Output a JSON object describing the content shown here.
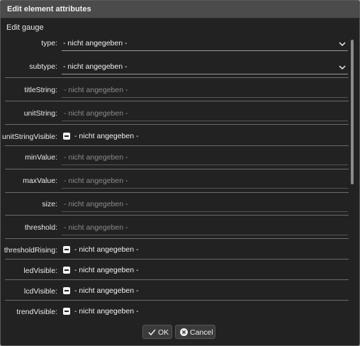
{
  "dialog": {
    "title": "Edit element attributes",
    "subtitle": "Edit gauge"
  },
  "fields": {
    "type": {
      "label": "type:",
      "value": "- nicht angegeben -"
    },
    "subtype": {
      "label": "subtype:",
      "value": "- nicht angegeben -"
    },
    "titleString": {
      "label": "titleString:",
      "placeholder": "- nicht angegeben -"
    },
    "unitString": {
      "label": "unitString:",
      "placeholder": "- nicht angegeben -"
    },
    "unitStringVisible": {
      "label": "unitStringVisible:",
      "value": "- nicht angegeben -"
    },
    "minValue": {
      "label": "minValue:",
      "placeholder": "- nicht angegeben -"
    },
    "maxValue": {
      "label": "maxValue:",
      "placeholder": "- nicht angegeben -"
    },
    "size": {
      "label": "size:",
      "placeholder": "- nicht angegeben -"
    },
    "threshold": {
      "label": "threshold:",
      "placeholder": "- nicht angegeben -"
    },
    "thresholdRising": {
      "label": "thresholdRising:",
      "value": "- nicht angegeben -"
    },
    "ledVisible": {
      "label": "ledVisible:",
      "value": "- nicht angegeben -"
    },
    "lcdVisible": {
      "label": "lcdVisible:",
      "value": "- nicht angegeben -"
    },
    "trendVisible": {
      "label": "trendVisible:",
      "value": "- nicht angegeben -"
    }
  },
  "buttons": {
    "ok": "OK",
    "cancel": "Cancel"
  },
  "icons": {
    "select_chevron": "chevron-down-icon",
    "checkbox_state": "indeterminate",
    "ok": "check-icon",
    "cancel": "close-circle-icon"
  }
}
